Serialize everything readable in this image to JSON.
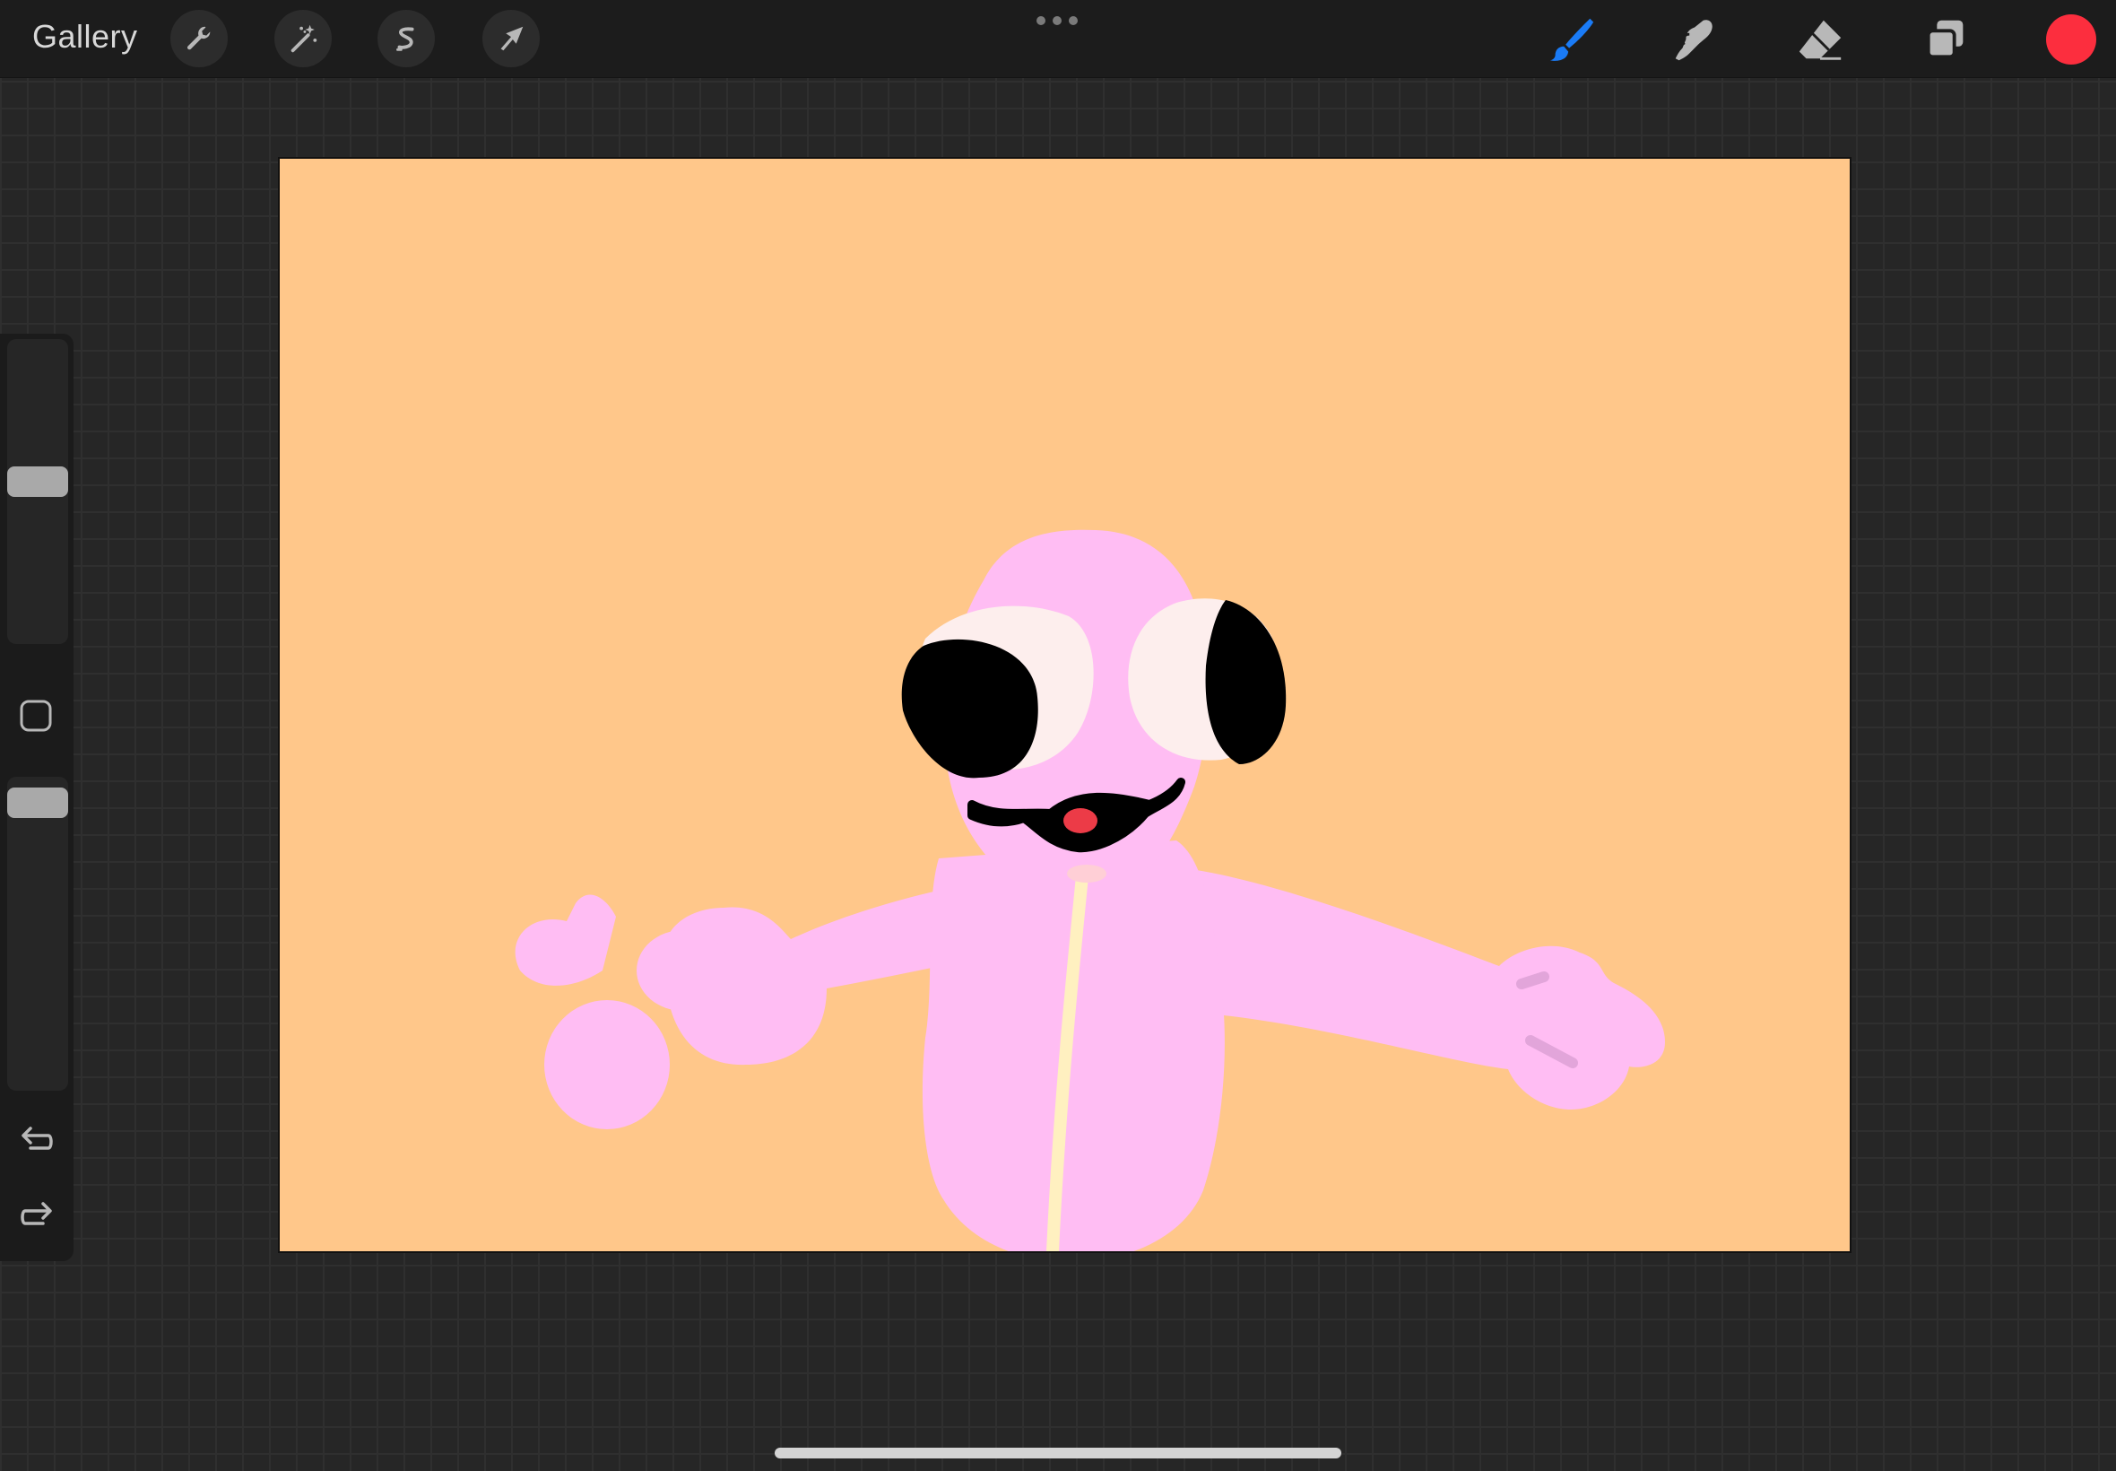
{
  "topbar": {
    "gallery_label": "Gallery",
    "left_tools": [
      {
        "name": "actions",
        "icon": "wrench-icon"
      },
      {
        "name": "adjustments",
        "icon": "magic-wand-icon"
      },
      {
        "name": "selection",
        "icon": "selection-s-icon"
      },
      {
        "name": "transform",
        "icon": "arrow-cursor-icon"
      }
    ],
    "more_icon": "more-dots-icon",
    "right_tools": [
      {
        "name": "brush",
        "icon": "brush-icon",
        "active": true
      },
      {
        "name": "smudge",
        "icon": "smudge-finger-icon",
        "active": false
      },
      {
        "name": "eraser",
        "icon": "eraser-icon",
        "active": false
      },
      {
        "name": "layers",
        "icon": "layers-icon",
        "active": false
      }
    ],
    "current_color": "#fc2e3e"
  },
  "sidebar": {
    "brush_size_slider": {
      "icon": "brush-size-slider"
    },
    "modifier_icon": "square-modifier-icon",
    "opacity_slider": {
      "icon": "opacity-slider"
    },
    "undo_icon": "undo-icon",
    "redo_icon": "redo-icon"
  },
  "canvas": {
    "background_color": "#ffc78a",
    "character_color": "#ffbdf3",
    "eye_white_color": "#fdeeed",
    "pupil_color": "#000000",
    "tongue_color": "#ec3b47",
    "zipper_color": "#fff0c0",
    "detail_color": "#e2a5da"
  },
  "system": {
    "home_indicator": "home-indicator"
  },
  "colors": {
    "toolbar_bg": "#1c1c1c",
    "workspace_bg": "#262626",
    "brush_accent": "#1a7bf6",
    "icon_gray": "#b8b8b8"
  }
}
